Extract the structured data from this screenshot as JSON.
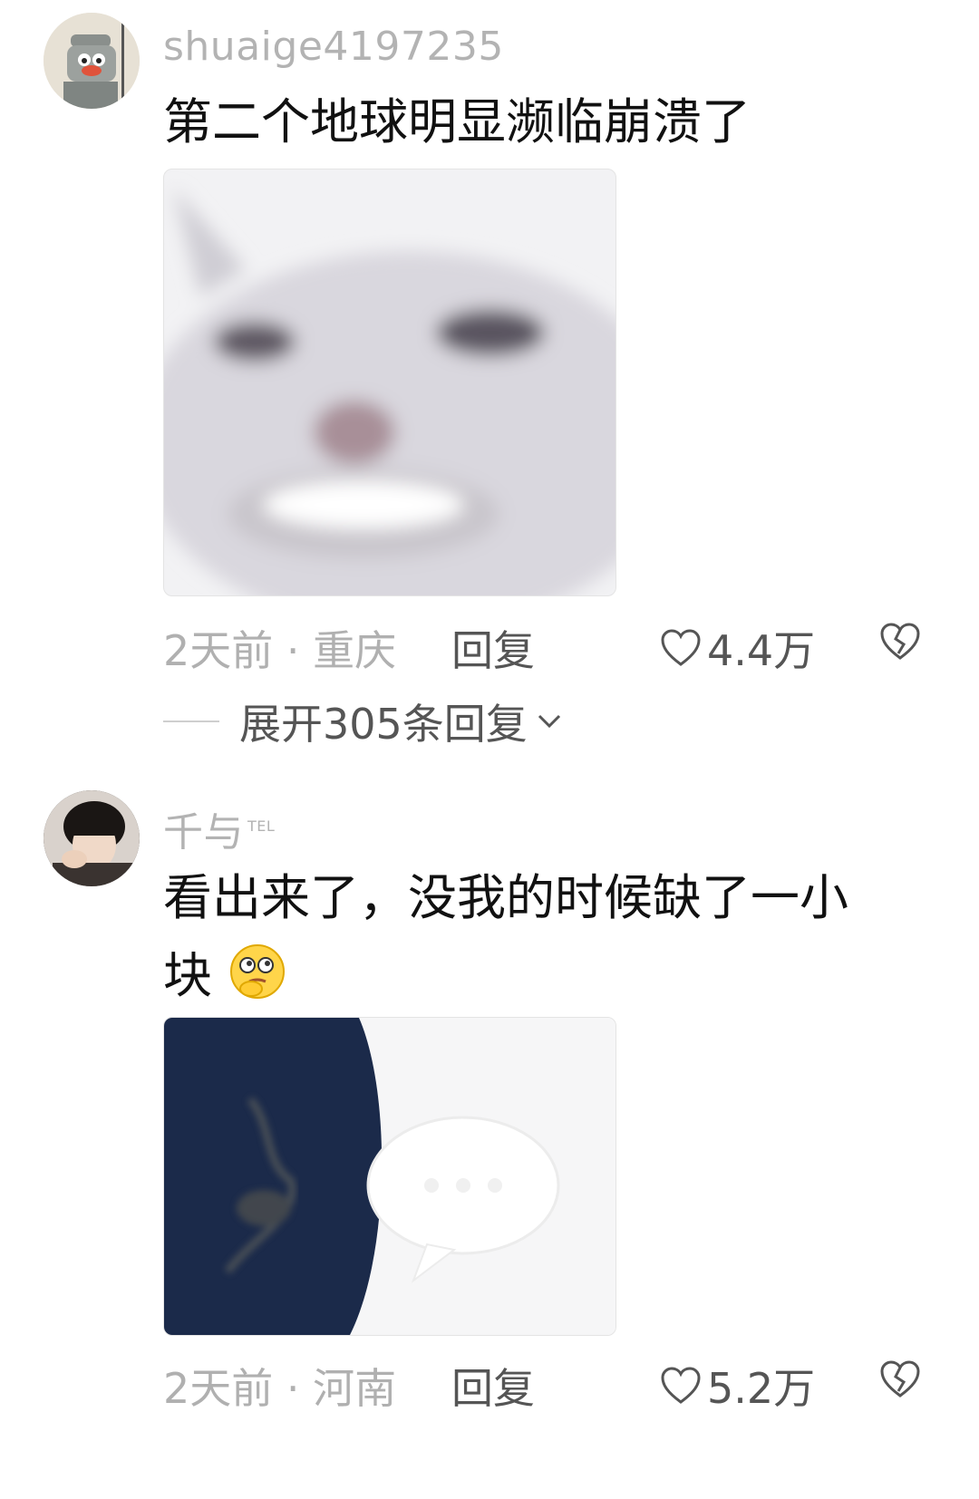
{
  "comments": [
    {
      "username": "shuaige4197235",
      "badge": "",
      "text": "第二个地球明显濒临崩溃了",
      "time_location": "2天前 · 重庆",
      "reply_label": "回复",
      "likes": "4.4万",
      "image": "meme-cat-smiling"
    },
    {
      "username": "千与",
      "badge": "TEL",
      "text": "看出来了，没我的时候缺了一小块",
      "emoji": "thinking-face-emoji",
      "time_location": "2天前 · 河南",
      "reply_label": "回复",
      "likes": "5.2万",
      "image": "earth-with-chat-bubble"
    }
  ],
  "expand_replies": "展开305条回复",
  "colors": {
    "meta_gray": "#b0b0b0",
    "text_dark": "#111111",
    "earth_blue": "#1b2a4a"
  }
}
